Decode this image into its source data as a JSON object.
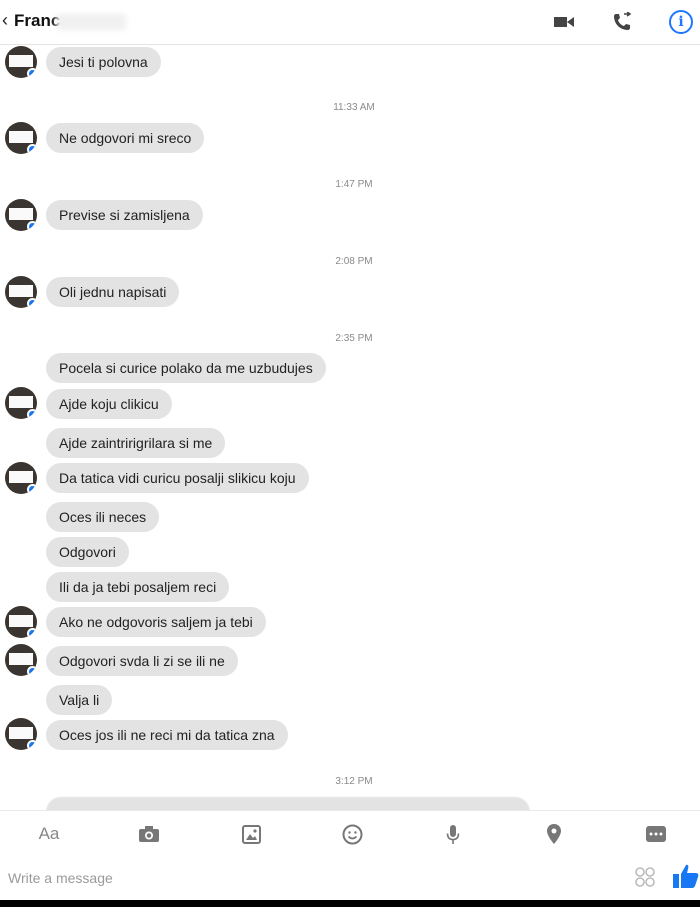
{
  "header": {
    "back_glyph": "‹",
    "contact_name": "Franc",
    "icons": [
      "video-camera-icon",
      "phone-icon",
      "info-icon"
    ]
  },
  "messages": [
    {
      "text": "Jesi ti polovna"
    },
    {
      "timestamp": "11:33 AM"
    },
    {
      "text": "Ne odgovori mi sreco"
    },
    {
      "timestamp": "1:47 PM"
    },
    {
      "text": "Previse si zamisljena"
    },
    {
      "timestamp": "2:08 PM"
    },
    {
      "text": "Oli jednu napisati"
    },
    {
      "timestamp": "2:35 PM"
    },
    {
      "text": "Pocela si curice polako da me uzbudujes"
    },
    {
      "text": "Ajde koju clikicu"
    },
    {
      "text": "Ajde zaintririgrilara si me"
    },
    {
      "text": "Da tatica vidi curicu posalji slikicu koju"
    },
    {
      "text": "Oces ili neces"
    },
    {
      "text": "Odgovori"
    },
    {
      "text": "Ili da ja tebi posaljem reci"
    },
    {
      "text": "Ako ne odgovoris saljem ja tebi"
    },
    {
      "text": "Odgovori svda li zi se ili ne"
    },
    {
      "text": "Valja li"
    },
    {
      "text": "Oces jos ili ne reci mi da tatica zna"
    },
    {
      "timestamp": "3:12 PM"
    }
  ],
  "toolbar": {
    "aa_label": "Aa",
    "icons": [
      "camera-icon",
      "image-icon",
      "emoji-icon",
      "microphone-icon",
      "location-icon",
      "more-icon"
    ]
  },
  "composer": {
    "placeholder": "Write a message"
  },
  "colors": {
    "accent": "#1877f2",
    "bubble": "#e3e3e3"
  }
}
